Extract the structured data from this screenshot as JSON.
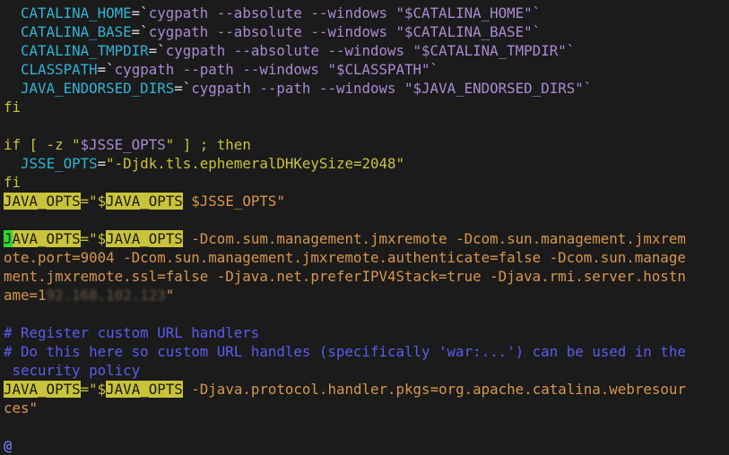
{
  "editor": {
    "lines": [
      [
        [
          "  ",
          ""
        ],
        [
          "CATALINA_HOME",
          "cyan"
        ],
        [
          "=`",
          "white"
        ],
        [
          "cygpath --absolute --windows \"$CATALINA_HOME\"`",
          "purple"
        ]
      ],
      [
        [
          "  ",
          ""
        ],
        [
          "CATALINA_BASE",
          "cyan"
        ],
        [
          "=`",
          "white"
        ],
        [
          "cygpath --absolute --windows \"$CATALINA_BASE\"`",
          "purple"
        ]
      ],
      [
        [
          "  ",
          ""
        ],
        [
          "CATALINA_TMPDIR",
          "cyan"
        ],
        [
          "=`",
          "white"
        ],
        [
          "cygpath --absolute --windows \"$CATALINA_TMPDIR\"`",
          "purple"
        ]
      ],
      [
        [
          "  ",
          ""
        ],
        [
          "CLASSPATH",
          "cyan"
        ],
        [
          "=`",
          "white"
        ],
        [
          "cygpath --path --windows \"$CLASSPATH\"`",
          "purple"
        ]
      ],
      [
        [
          "  ",
          ""
        ],
        [
          "JAVA_ENDORSED_DIRS",
          "cyan"
        ],
        [
          "=`",
          "white"
        ],
        [
          "cygpath --path --windows \"$JAVA_ENDORSED_DIRS\"`",
          "purple"
        ]
      ],
      [
        [
          "fi",
          "yellow"
        ]
      ],
      [],
      [
        [
          "if [ -z \"",
          "yellow"
        ],
        [
          "$JSSE_OPTS",
          "purple"
        ],
        [
          "\" ] ; then",
          "yellow"
        ]
      ],
      [
        [
          "  ",
          ""
        ],
        [
          "JSSE_OPTS",
          "cyan"
        ],
        [
          "=",
          "white"
        ],
        [
          "\"-Djdk.tls.ephemeralDHKeySize=2048\"",
          "yellow"
        ]
      ],
      [
        [
          "fi",
          "yellow"
        ]
      ],
      [
        [
          "JAVA_OPTS",
          "hl"
        ],
        [
          "=\"$",
          "yellow"
        ],
        [
          "JAVA_OPTS",
          "hl"
        ],
        [
          " $JSSE_OPTS\"",
          "orange"
        ]
      ],
      [],
      [
        [
          "J",
          "cursor"
        ],
        [
          "AVA_OPTS",
          "hl"
        ],
        [
          "=\"$",
          "yellow"
        ],
        [
          "JAVA_OPTS",
          "hl"
        ],
        [
          " -Dcom.sum.management.jmxremote -Dcom.sun.management.jmxrem",
          "orange"
        ]
      ],
      [
        [
          "ote.port=9004 -Dcom.sun.management.jmxremote.authenticate=false -Dcom.sun.manage",
          "orange"
        ]
      ],
      [
        [
          "ment.jmxremote.ssl=false -Djava.net.preferIPV4Stack=true -Djava.rmi.server.hostn",
          "orange"
        ]
      ],
      [
        [
          "ame=1",
          "orange"
        ],
        [
          "92.168.102.123",
          "blur"
        ],
        [
          "\"",
          "orange"
        ]
      ],
      [],
      [
        [
          "# Register custom URL handlers",
          "comment"
        ]
      ],
      [
        [
          "# Do this here so custom URL handles (specifically 'war:...') can be used in the",
          "comment"
        ]
      ],
      [
        [
          " security policy",
          "comment"
        ]
      ],
      [
        [
          "JAVA_OPTS",
          "hl"
        ],
        [
          "=\"$",
          "yellow"
        ],
        [
          "JAVA_OPTS",
          "hl"
        ],
        [
          " -Djava.protocol.handler.pkgs=org.apache.catalina.webresour",
          "orange"
        ]
      ],
      [
        [
          "ces\"",
          "orange"
        ]
      ],
      [],
      [
        [
          "@",
          "tilde"
        ]
      ]
    ]
  }
}
